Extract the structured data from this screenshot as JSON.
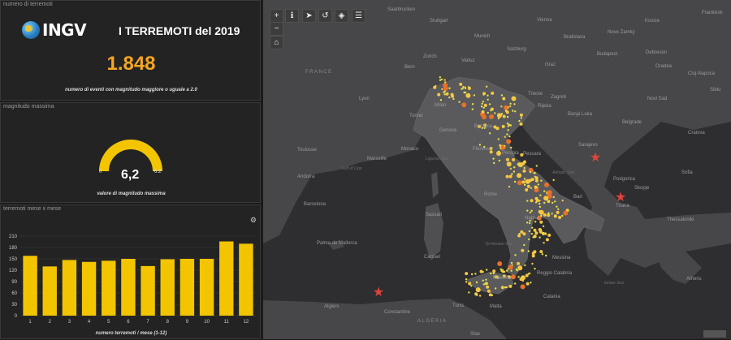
{
  "panel1": {
    "title": "numero di terremoti",
    "logo": "INGV",
    "heading": "I TERREMOTI del 2019",
    "count": "1.848",
    "caption": "numero di eventi con magnitudo maggiore o uguale a 2.0"
  },
  "panel2": {
    "title": "magnitudo massima",
    "value": "6,2",
    "min": "0",
    "max": "6.2",
    "gauge_fraction": 1.0,
    "caption": "valore di magnitudo massima"
  },
  "panel3": {
    "title": "terremoti mese x mese",
    "xlabel": "numero terremoti / mese (1-12)",
    "settings_icon": "gear-icon"
  },
  "colors": {
    "accent": "#f5a623",
    "bar": "#f2c500",
    "gauge": "#f2c500",
    "map_bg": "#2e2e30",
    "land": "#4a4a4c",
    "italy": "#5a5a5c"
  },
  "chart_data": {
    "type": "bar",
    "categories": [
      "1",
      "2",
      "3",
      "4",
      "5",
      "6",
      "7",
      "8",
      "9",
      "10",
      "11",
      "12"
    ],
    "values": [
      158,
      130,
      147,
      142,
      145,
      150,
      131,
      149,
      150,
      150,
      196,
      190
    ],
    "xlabel": "numero terremoti / mese (1-12)",
    "ylabel": "",
    "yticks": [
      0,
      30,
      60,
      90,
      120,
      150,
      180,
      210
    ],
    "ylim": [
      0,
      210
    ],
    "grid": true
  },
  "map": {
    "toolbar": {
      "zoom_in": "+",
      "zoom_out": "−",
      "home_icon": "home-icon",
      "info_icon": "info-icon",
      "layers_icon": "layers-icon",
      "history_icon": "history-icon",
      "list_icon": "list-icon",
      "share_icon": "share-icon"
    },
    "countries": [
      "FRANCE",
      "ALGERIA"
    ],
    "cities": [
      "Saarbrucken",
      "Stuttgart",
      "Munich",
      "Salzburg",
      "Vienna",
      "Bratislava",
      "Kosice",
      "Nove Zamky",
      "Frankivsk",
      "Bern",
      "Zurich",
      "Vaduz",
      "Graz",
      "Budapest",
      "Debrecen",
      "Oradea",
      "Cluj-Napoca",
      "Sibiu",
      "Lyon",
      "Milan",
      "Trieste",
      "Zagreb",
      "Rijeka",
      "Novi Sad",
      "Belgrade",
      "Craiova",
      "Banja Luka",
      "Sarajevo",
      "Torino",
      "Genova",
      "Bologna",
      "Florence",
      "Toulouse",
      "Monaco",
      "Marseille",
      "Perugia",
      "Pescara",
      "Podgorica",
      "Sofia",
      "Skopje",
      "Andorra",
      "Barcelona",
      "Rome",
      "Naples",
      "Bari",
      "Tirana",
      "Thessaloniki",
      "Palma de Mallorca",
      "Sassari",
      "Cagliari",
      "Palermo",
      "Messina",
      "Reggio Calabria",
      "Catania",
      "Athens",
      "Algiers",
      "Constantine",
      "Tunis",
      "Sfax",
      "Malta",
      "Valencia",
      "Annaba",
      "Patras"
    ],
    "seas": [
      "Ligurian Sea",
      "Gulf of Lion",
      "Tyrrhenian Sea",
      "Adriatic Sea",
      "Ionian Sea"
    ]
  }
}
